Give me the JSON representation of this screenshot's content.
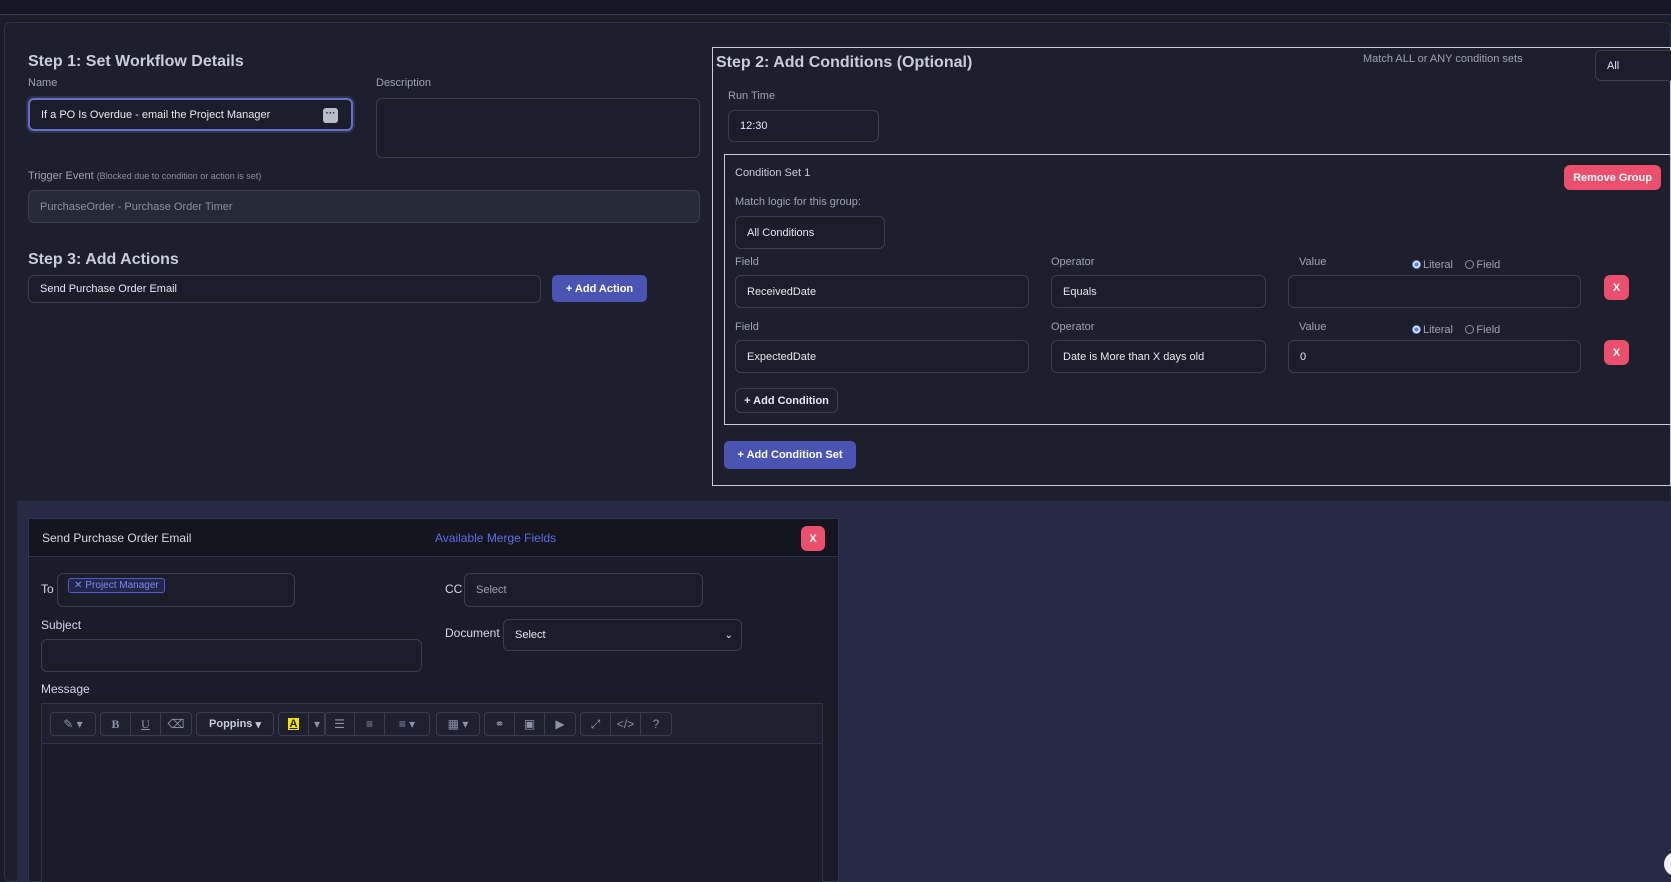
{
  "step1": {
    "heading": "Step 1: Set Workflow Details",
    "name_label": "Name",
    "name_value": "If a PO Is Overdue - email the Project Manager",
    "description_label": "Description",
    "description_value": "",
    "trigger_label": "Trigger Event",
    "trigger_note": "(Blocked due to condition or action is set)",
    "trigger_value": "PurchaseOrder - Purchase Order Timer"
  },
  "step3": {
    "heading": "Step 3: Add Actions",
    "action_value": "Send Purchase Order Email",
    "add_action_label": "+ Add Action"
  },
  "step2": {
    "heading": "Step 2: Add Conditions (Optional)",
    "match_all_any_label": "Match ALL or ANY condition sets",
    "match_all_any_value": "All",
    "run_time_label": "Run Time",
    "run_time_value": "12:30",
    "condition_set": {
      "title": "Condition Set 1",
      "remove_label": "Remove Group",
      "match_logic_label": "Match logic for this group:",
      "match_logic_value": "All Conditions",
      "field_label": "Field",
      "operator_label": "Operator",
      "value_label": "Value",
      "literal_label": "Literal",
      "field_radio_label": "Field",
      "rows": [
        {
          "field": "ReceivedDate",
          "operator": "Equals",
          "value": "",
          "mode": "Literal"
        },
        {
          "field": "ExpectedDate",
          "operator": "Date is More than X days old",
          "value": "0",
          "mode": "Literal"
        }
      ],
      "remove_row_label": "X",
      "add_condition_label": "+ Add Condition"
    },
    "add_condition_set_label": "+ Add Condition Set"
  },
  "email": {
    "title": "Send Purchase Order Email",
    "merge_fields_label": "Available Merge Fields",
    "close_label": "X",
    "to_label": "To",
    "to_chip": "Project Manager",
    "cc_label": "CC",
    "cc_placeholder": "Select",
    "subject_label": "Subject",
    "subject_value": "",
    "document_label": "Document",
    "document_value": "Select",
    "message_label": "Message",
    "toolbar": {
      "font_name": "Poppins",
      "help": "?"
    }
  },
  "colors": {
    "background": "#1b1d29",
    "accent_blue": "#4a54b3",
    "danger_red": "#ec4f6c",
    "link_blue": "#5b6ee8"
  }
}
